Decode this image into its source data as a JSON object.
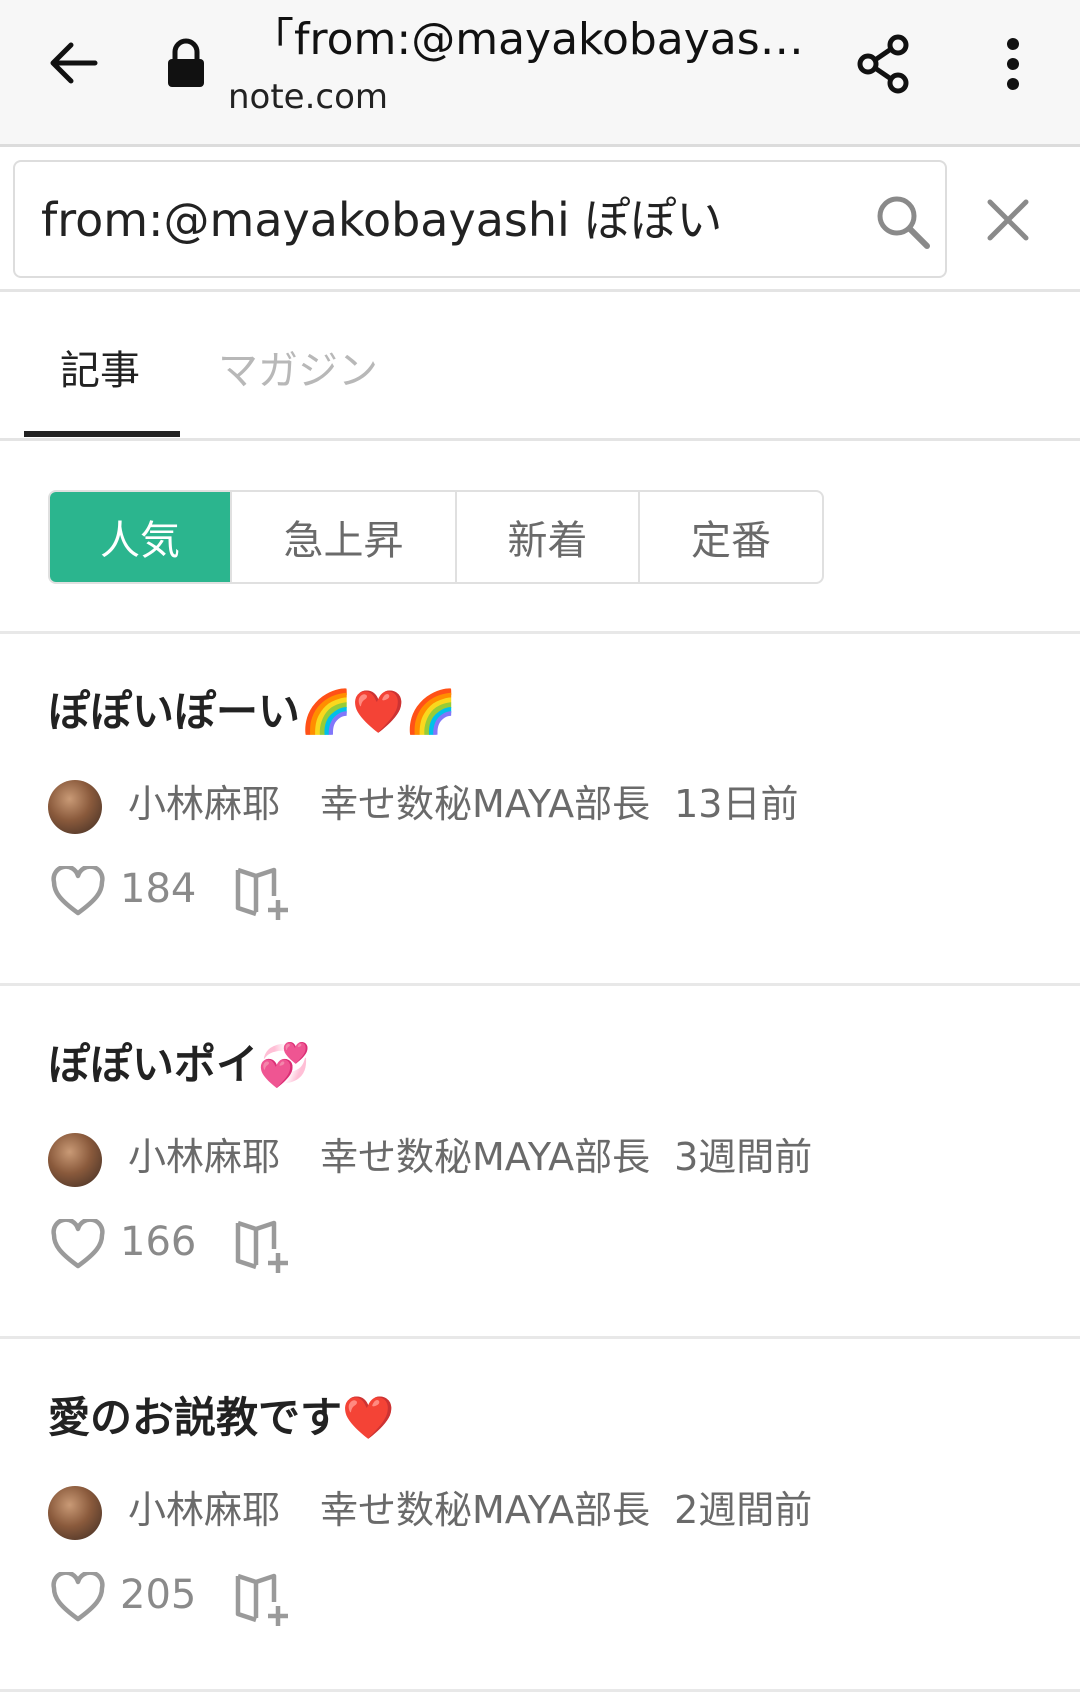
{
  "browser": {
    "title": "「from:@mayakobayash…",
    "domain": "note.com"
  },
  "search": {
    "query": "from:@mayakobayashi ぽぽい"
  },
  "tabs": [
    {
      "label": "記事",
      "active": true
    },
    {
      "label": "マガジン",
      "active": false
    }
  ],
  "sort": [
    {
      "label": "人気",
      "active": true
    },
    {
      "label": "急上昇",
      "active": false
    },
    {
      "label": "新着",
      "active": false
    },
    {
      "label": "定番",
      "active": false
    }
  ],
  "colors": {
    "accent": "#2bb58e"
  },
  "articles": [
    {
      "title": "ぽぽいぽーい🌈❤️🌈",
      "author": "小林麻耶",
      "magazine": "幸せ数秘MAYA部長",
      "date": "13日前",
      "likes": "184"
    },
    {
      "title": "ぽぽいポイ💞",
      "author": "小林麻耶",
      "magazine": "幸せ数秘MAYA部長",
      "date": "3週間前",
      "likes": "166"
    },
    {
      "title": "愛のお説教です❤️",
      "author": "小林麻耶",
      "magazine": "幸せ数秘MAYA部長",
      "date": "2週間前",
      "likes": "205"
    }
  ]
}
